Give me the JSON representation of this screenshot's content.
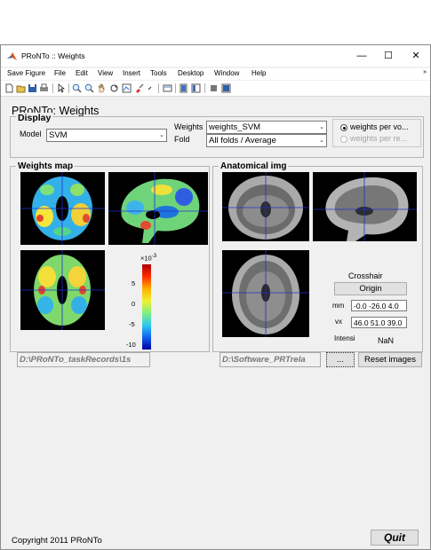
{
  "window": {
    "title": "PRoNTo :: Weights",
    "minimize_glyph": "—",
    "maximize_glyph": "☐",
    "close_glyph": "✕"
  },
  "menu": [
    "Save Figure",
    "File",
    "Edit",
    "View",
    "Insert",
    "Tools",
    "Desktop",
    "Window",
    "Help"
  ],
  "menu_overflow": "»",
  "toolbar_icons": [
    "new-file-icon",
    "open-folder-icon",
    "save-icon",
    "print-icon",
    "pointer-icon",
    "zoom-in-icon",
    "zoom-out-icon",
    "pan-icon",
    "rotate-icon",
    "data-cursor-icon",
    "brush-icon",
    "link-icon",
    "colorbar-icon",
    "legend-icon",
    "hide-tools-icon",
    "show-tools-icon"
  ],
  "header": {
    "title": "PRoNTo: Weights"
  },
  "display": {
    "title": "Display",
    "model_label": "Model",
    "model_value": "SVM",
    "weights_label": "Weights",
    "weights_value": "weights_SVM",
    "fold_label": "Fold",
    "fold_value": "All folds / Average",
    "radio_weights": "weights per vo...",
    "radio_weights_region": "weights per re..."
  },
  "weights_map": {
    "title": "Weights map",
    "colorbar_exponent": "×10",
    "colorbar_power": "-3",
    "colorbar_ticks": [
      "5",
      "0",
      "-5",
      "-10"
    ],
    "path": "D:\\PRoNTo_taskRecords\\1s"
  },
  "anatomical": {
    "title": "Anatomical img",
    "crosshair_label": "Crosshair",
    "origin_button": "Origin",
    "mm_label": "mm",
    "mm_value": "-0.0 -26.0 4.0",
    "vx_label": "vx",
    "vx_value": "46.0 51.0 39.0",
    "intensity_label": "Intensi",
    "intensity_value": "NaN",
    "path": "D:\\Software_PRTrela",
    "browse_button": "...",
    "reset_button": "Reset images"
  },
  "footer": {
    "copyright": "Copyright 2011 PRoNTo",
    "quit_button": "Quit"
  }
}
